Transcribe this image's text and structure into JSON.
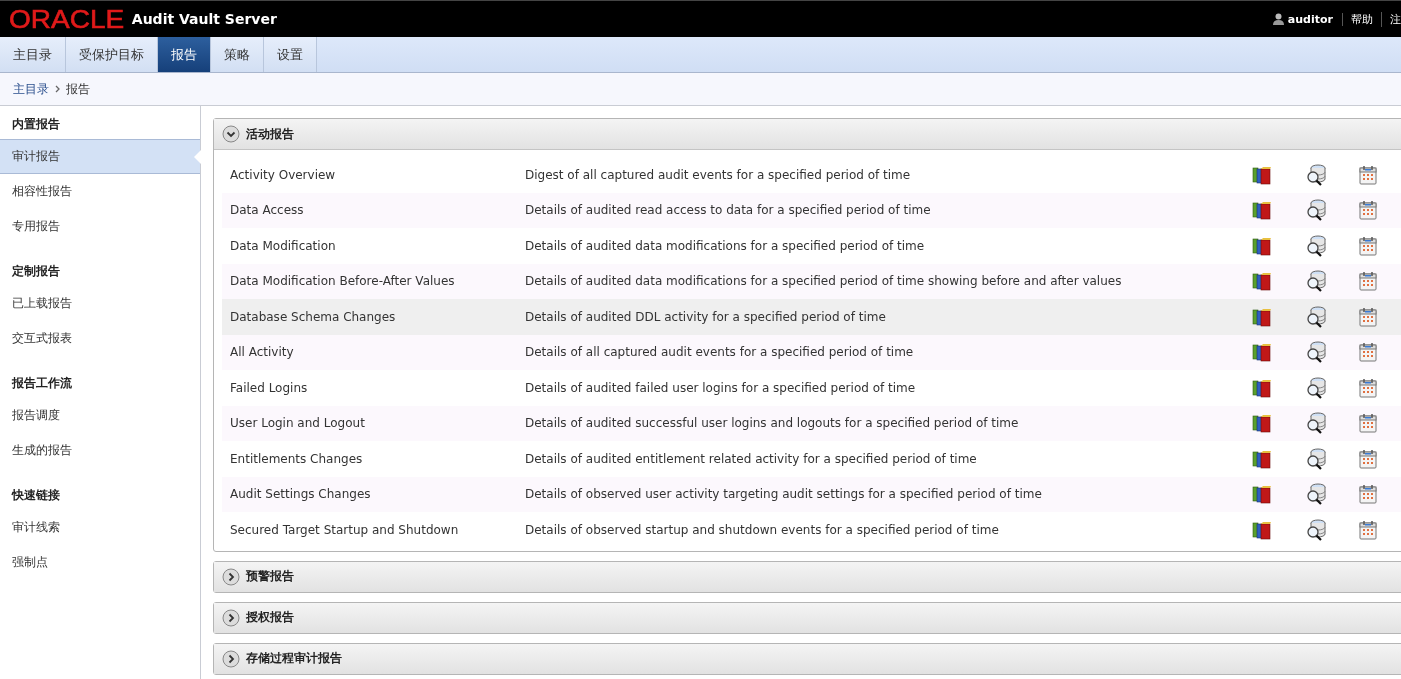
{
  "header": {
    "brand": "ORACLE",
    "product": "Audit Vault Server",
    "user": "auditor",
    "links": [
      "帮助",
      "注"
    ]
  },
  "tabs": [
    {
      "label": "主目录",
      "selected": false
    },
    {
      "label": "受保护目标",
      "selected": false
    },
    {
      "label": "报告",
      "selected": true
    },
    {
      "label": "策略",
      "selected": false
    },
    {
      "label": "设置",
      "selected": false
    }
  ],
  "breadcrumb": [
    {
      "label": "主目录",
      "kind": "link"
    },
    {
      "label": "报告",
      "kind": "current"
    }
  ],
  "sidebar": {
    "sections": [
      {
        "heading": "内置报告",
        "items": [
          {
            "label": "审计报告",
            "selected": true
          },
          {
            "label": "相容性报告",
            "selected": false
          },
          {
            "label": "专用报告",
            "selected": false
          }
        ]
      },
      {
        "heading": "定制报告",
        "items": [
          {
            "label": "已上载报告",
            "selected": false
          },
          {
            "label": "交互式报表",
            "selected": false
          }
        ]
      },
      {
        "heading": "报告工作流",
        "items": [
          {
            "label": "报告调度",
            "selected": false
          },
          {
            "label": "生成的报告",
            "selected": false
          }
        ]
      },
      {
        "heading": "快速链接",
        "items": [
          {
            "label": "审计线索",
            "selected": false
          },
          {
            "label": "强制点",
            "selected": false
          }
        ]
      }
    ]
  },
  "panels": [
    {
      "title": "活动报告",
      "expanded": true,
      "rows": [
        {
          "name": "Activity Overview",
          "description": "Digest of all captured audit events for a specified period of time",
          "hovered": false
        },
        {
          "name": "Data Access",
          "description": "Details of audited read access to data for a specified period of time",
          "hovered": false
        },
        {
          "name": "Data Modification",
          "description": "Details of audited data modifications for a specified period of time",
          "hovered": false
        },
        {
          "name": "Data Modification Before-After Values",
          "description": "Details of audited data modifications for a specified period of time showing before and after values",
          "hovered": false
        },
        {
          "name": "Database Schema Changes",
          "description": "Details of audited DDL activity for a specified period of time",
          "hovered": true
        },
        {
          "name": "All Activity",
          "description": "Details of all captured audit events for a specified period of time",
          "hovered": false
        },
        {
          "name": "Failed Logins",
          "description": "Details of audited failed user logins for a specified period of time",
          "hovered": false
        },
        {
          "name": "User Login and Logout",
          "description": "Details of audited successful user logins and logouts for a specified period of time",
          "hovered": false
        },
        {
          "name": "Entitlements Changes",
          "description": "Details of audited entitlement related activity for a specified period of time",
          "hovered": false
        },
        {
          "name": "Audit Settings Changes",
          "description": "Details of observed user activity targeting audit settings for a specified period of time",
          "hovered": false
        },
        {
          "name": "Secured Target Startup and Shutdown",
          "description": "Details of observed startup and shutdown events for a specified period of time",
          "hovered": false
        }
      ]
    },
    {
      "title": "预警报告",
      "expanded": false
    },
    {
      "title": "授权报告",
      "expanded": false
    },
    {
      "title": "存储过程审计报告",
      "expanded": false
    }
  ]
}
